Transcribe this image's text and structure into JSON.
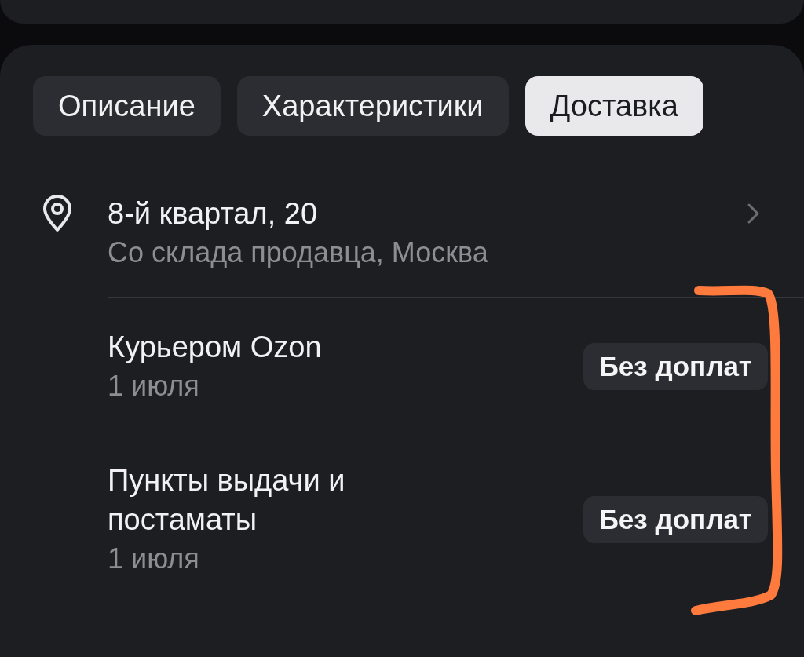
{
  "tabs": [
    {
      "label": "Описание",
      "selected": false
    },
    {
      "label": "Характеристики",
      "selected": false
    },
    {
      "label": "Доставка",
      "selected": true
    }
  ],
  "address": {
    "title": "8-й квартал, 20",
    "subtitle": "Со склада продавца, Москва"
  },
  "delivery_options": [
    {
      "name": "Курьером Ozon",
      "date": "1 июля",
      "badge": "Без доплат"
    },
    {
      "name": "Пункты выдачи и постаматы",
      "date": "1 июля",
      "badge": "Без доплат"
    }
  ]
}
